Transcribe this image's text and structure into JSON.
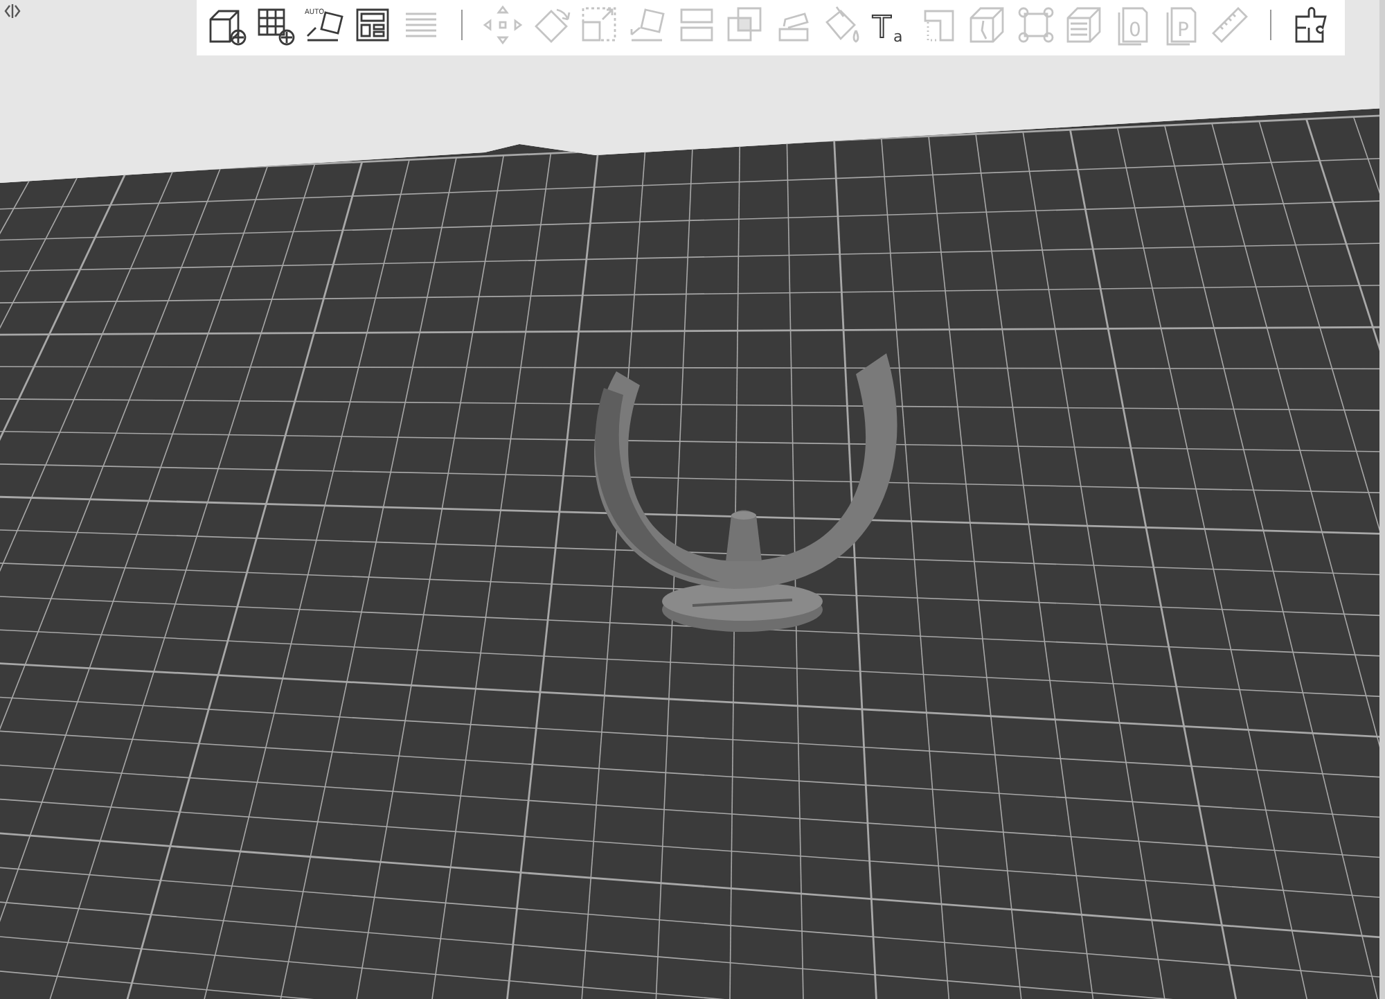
{
  "toolbar": {
    "items": [
      {
        "kind": "add",
        "disabled": false
      },
      {
        "kind": "add-instance",
        "disabled": false
      },
      {
        "kind": "arrange",
        "label": "AUTO",
        "disabled": false
      },
      {
        "kind": "layout",
        "disabled": false
      },
      {
        "kind": "layers",
        "disabled": true
      },
      {
        "kind": "separator"
      },
      {
        "kind": "move",
        "disabled": true
      },
      {
        "kind": "rotate",
        "disabled": true
      },
      {
        "kind": "scale",
        "disabled": true
      },
      {
        "kind": "place-on-face",
        "disabled": true
      },
      {
        "kind": "cut",
        "disabled": true
      },
      {
        "kind": "boolean",
        "disabled": true
      },
      {
        "kind": "support-paint",
        "disabled": true
      },
      {
        "kind": "paint-bucket",
        "disabled": true
      },
      {
        "kind": "text",
        "label": "T",
        "label_2": "a",
        "disabled": false
      },
      {
        "kind": "hollow",
        "disabled": true
      },
      {
        "kind": "crack-cube",
        "disabled": true
      },
      {
        "kind": "brim-ears",
        "disabled": true
      },
      {
        "kind": "layer-stack",
        "disabled": true
      },
      {
        "kind": "letter-box",
        "label": "0",
        "disabled": true
      },
      {
        "kind": "letter-box",
        "label": "P",
        "disabled": true
      },
      {
        "kind": "ruler",
        "disabled": true
      },
      {
        "kind": "separator"
      },
      {
        "kind": "puzzle",
        "disabled": false
      }
    ]
  }
}
